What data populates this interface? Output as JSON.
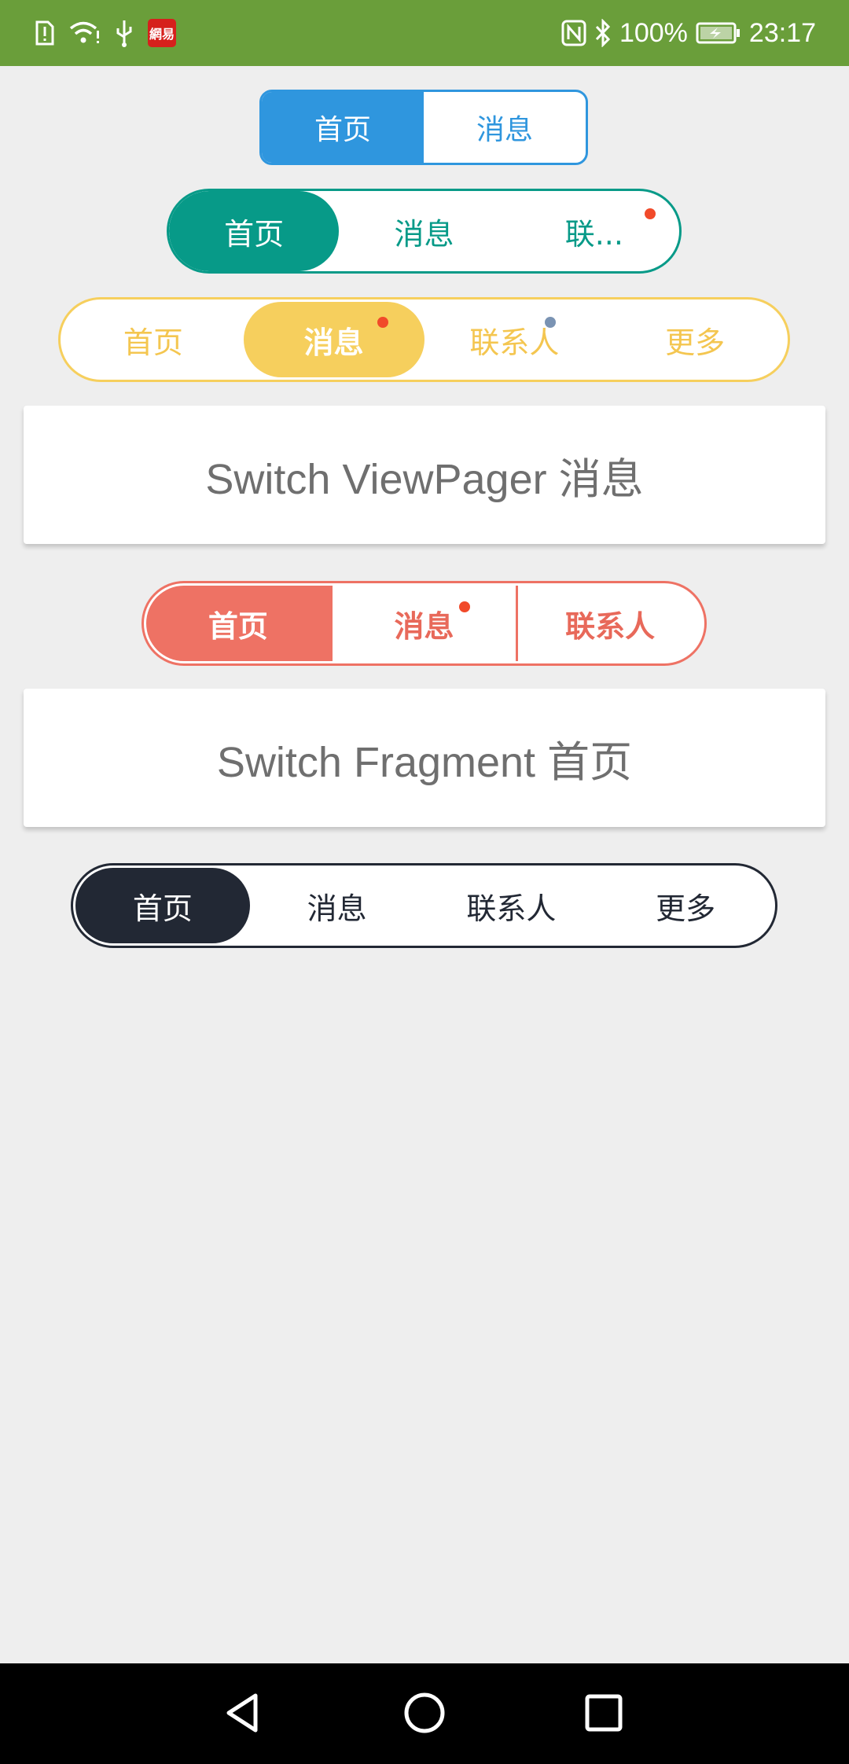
{
  "status_bar": {
    "battery": "100%",
    "time": "23:17",
    "app_badge": "網易",
    "icons": [
      "sim-alert-icon",
      "wifi-icon",
      "usb-icon",
      "netease-app-icon",
      "nfc-icon",
      "bluetooth-icon",
      "battery-charging-icon"
    ]
  },
  "seg1": {
    "tabs": [
      {
        "label": "首页"
      },
      {
        "label": "消息"
      }
    ]
  },
  "seg2": {
    "tabs": [
      {
        "label": "首页"
      },
      {
        "label": "消息"
      },
      {
        "label": "联..."
      }
    ]
  },
  "seg3": {
    "tabs": [
      {
        "label": "首页"
      },
      {
        "label": "消息"
      },
      {
        "label": "联系人"
      },
      {
        "label": "更多"
      }
    ]
  },
  "card1": {
    "text": "Switch ViewPager 消息"
  },
  "seg4": {
    "tabs": [
      {
        "label": "首页"
      },
      {
        "label": "消息"
      },
      {
        "label": "联系人"
      }
    ]
  },
  "card2": {
    "text": "Switch Fragment 首页"
  },
  "seg5": {
    "tabs": [
      {
        "label": "首页"
      },
      {
        "label": "消息"
      },
      {
        "label": "联系人"
      },
      {
        "label": "更多"
      }
    ]
  },
  "nav_bar": {
    "buttons": [
      "back-icon",
      "home-icon",
      "recents-icon"
    ]
  },
  "colors": {
    "status_bar": "#6a9e3a",
    "blue": "#2f96de",
    "teal": "#079a88",
    "yellow": "#f6cf5d",
    "salmon": "#ee7264",
    "dark": "#222834",
    "badge_red": "#f14a2a",
    "badge_gray": "#7a93b3"
  }
}
